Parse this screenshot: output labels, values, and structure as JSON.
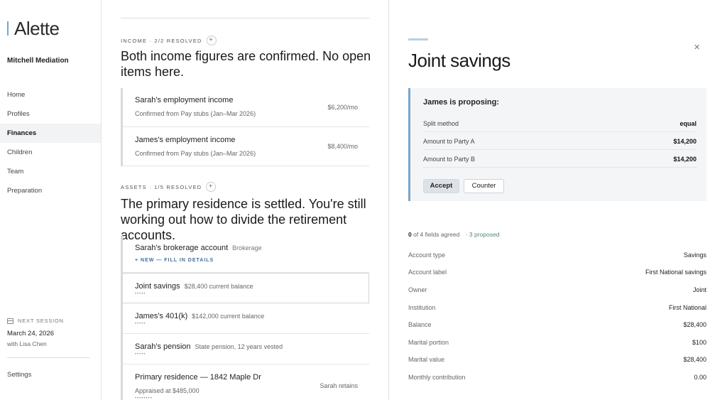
{
  "app": {
    "name": "Alette",
    "org": "Mitchell Mediation"
  },
  "nav": [
    "Home",
    "Profiles",
    "Finances",
    "Children",
    "Team",
    "Preparation"
  ],
  "next_session": {
    "label": "NEXT SESSION",
    "date": "March 24, 2026",
    "with": "with Lisa Chen"
  },
  "settings_label": "Settings",
  "income": {
    "label": "INCOME · 2/2 RESOLVED",
    "headline": "Both income figures are confirmed. No open items here.",
    "items": [
      {
        "title": "Sarah's employment income",
        "sub": "Confirmed from Pay stubs (Jan–Mar 2026)",
        "amount": "$6,200/mo"
      },
      {
        "title": "James's employment income",
        "sub": "Confirmed from Pay stubs (Jan–Mar 2026)",
        "amount": "$8,400/mo"
      }
    ]
  },
  "assets": {
    "label": "ASSETS · 1/5 RESOLVED",
    "headline": "The primary residence is settled. You're still working out how to divide the retirement accounts.",
    "items": [
      {
        "title": "Sarah's brokerage account",
        "tag": "Brokerage",
        "new_label": "+ NEW — FILL IN DETAILS"
      },
      {
        "title": "Joint savings",
        "desc": "$28,400 current balance",
        "dots": "•••••"
      },
      {
        "title": "James's 401(k)",
        "desc": "$142,000 current balance",
        "dots": "•••••"
      },
      {
        "title": "Sarah's pension",
        "desc": "State pension, 12 years vested",
        "dots": "•••••"
      },
      {
        "title": "Primary residence — 1842 Maple Dr",
        "sub": "Appraised at $485,000",
        "amount": "Sarah retains",
        "dots": "••••••••"
      }
    ]
  },
  "panel": {
    "title": "Joint savings",
    "close_icon": "close-icon",
    "proposal": {
      "heading": "James is proposing:",
      "rows": [
        {
          "k": "Split method",
          "v": "equal"
        },
        {
          "k": "Amount to Party A",
          "v": "$14,200"
        },
        {
          "k": "Amount to Party B",
          "v": "$14,200"
        }
      ],
      "accept": "Accept",
      "counter": "Counter"
    },
    "agreed": {
      "count": "0",
      "text": "of 4 fields agreed",
      "proposed": "· 3 proposed"
    },
    "fields": [
      {
        "k": "Account type",
        "v": "Savings"
      },
      {
        "k": "Account label",
        "v": "First National savings"
      },
      {
        "k": "Owner",
        "v": "Joint"
      },
      {
        "k": "Institution",
        "v": "First National"
      },
      {
        "k": "Balance",
        "v": "$28,400"
      },
      {
        "k": "Marital portion",
        "v": "$100"
      },
      {
        "k": "Marital value",
        "v": "$28,400"
      },
      {
        "k": "Monthly contribution",
        "v": "0.00"
      }
    ]
  }
}
